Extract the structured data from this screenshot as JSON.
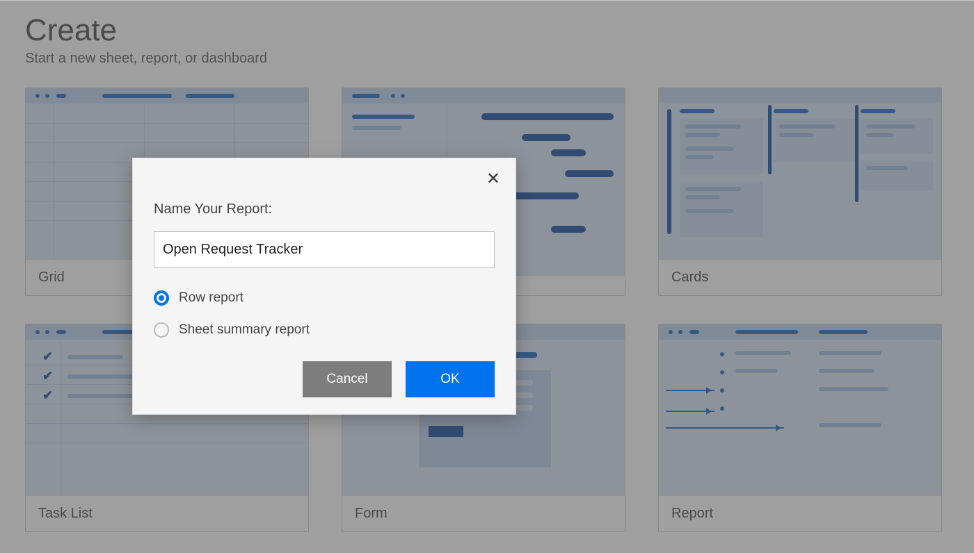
{
  "header": {
    "title": "Create",
    "subtitle": "Start a new sheet, report, or dashboard"
  },
  "tiles": {
    "grid": "Grid",
    "gantt": "",
    "cards": "Cards",
    "tasklist": "Task List",
    "form": "Form",
    "report": "Report"
  },
  "modal": {
    "title": "Name Your Report:",
    "input_value": "Open Request Tracker",
    "options": {
      "row": "Row report",
      "summary": "Sheet summary report"
    },
    "selected": "row",
    "buttons": {
      "cancel": "Cancel",
      "ok": "OK"
    }
  }
}
